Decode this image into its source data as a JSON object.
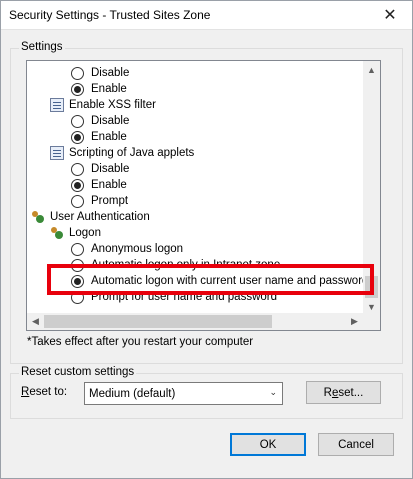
{
  "window": {
    "title": "Security Settings - Trusted Sites Zone",
    "close_glyph": "✕"
  },
  "settings_group": {
    "legend": "Settings",
    "items": [
      {
        "kind": "radio",
        "label": "Disable",
        "checked": false
      },
      {
        "kind": "radio",
        "label": "Enable",
        "checked": true
      },
      {
        "kind": "setting",
        "label": "Enable XSS filter",
        "icon": "setting-icon"
      },
      {
        "kind": "radio",
        "label": "Disable",
        "checked": false
      },
      {
        "kind": "radio",
        "label": "Enable",
        "checked": true
      },
      {
        "kind": "setting",
        "label": "Scripting of Java applets",
        "icon": "setting-icon"
      },
      {
        "kind": "radio",
        "label": "Disable",
        "checked": false
      },
      {
        "kind": "radio",
        "label": "Enable",
        "checked": true
      },
      {
        "kind": "radio",
        "label": "Prompt",
        "checked": false
      },
      {
        "kind": "category",
        "label": "User Authentication",
        "icon": "users-icon"
      },
      {
        "kind": "setting",
        "label": "Logon",
        "icon": "users-icon"
      },
      {
        "kind": "radio",
        "label": "Anonymous logon",
        "checked": false
      },
      {
        "kind": "radio",
        "label": "Automatic logon only in Intranet zone",
        "checked": false
      },
      {
        "kind": "radio",
        "label": "Automatic logon with current user name and password",
        "checked": true
      },
      {
        "kind": "radio",
        "label": "Prompt for user name and password",
        "checked": false
      }
    ],
    "scroll_arrows": {
      "up": "▲",
      "down": "▼",
      "left": "◀",
      "right": "▶"
    }
  },
  "footnote": "*Takes effect after you restart your computer",
  "reset_group": {
    "legend": "Reset custom settings",
    "label_prefix": "R",
    "label_rest": "eset to:",
    "selected_value": "Medium (default)",
    "chevron": "⌄",
    "reset_button_prefix": "R",
    "reset_button_access": "e",
    "reset_button_rest": "set..."
  },
  "buttons": {
    "ok": "OK",
    "cancel": "Cancel"
  },
  "annotation_color": "#e8000c"
}
